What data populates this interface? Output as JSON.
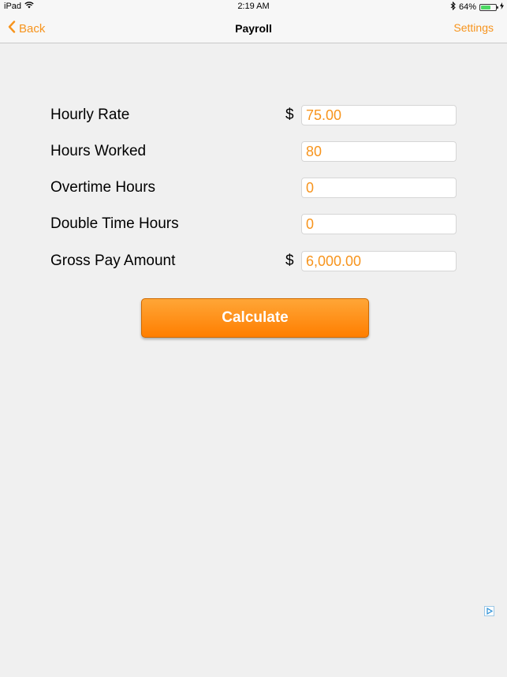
{
  "statusbar": {
    "device": "iPad",
    "time": "2:19 AM",
    "battery_text": "64%",
    "battery_level": 0.64
  },
  "navbar": {
    "back_label": "Back",
    "title": "Payroll",
    "settings_label": "Settings"
  },
  "form": {
    "hourly_rate": {
      "label": "Hourly Rate",
      "currency": "$",
      "value": "75.00"
    },
    "hours_worked": {
      "label": "Hours Worked",
      "value": "80"
    },
    "overtime_hours": {
      "label": "Overtime Hours",
      "value": "0"
    },
    "double_time_hours": {
      "label": "Double Time Hours",
      "value": "0"
    },
    "gross_pay": {
      "label": "Gross Pay Amount",
      "currency": "$",
      "value": "6,000.00"
    }
  },
  "calculate_label": "Calculate",
  "colors": {
    "accent": "#f7941d",
    "button_top": "#ffa637",
    "button_bottom": "#ff7e00",
    "background": "#f0f0f0"
  },
  "icons": [
    "wifi-icon",
    "bluetooth-icon",
    "battery-icon",
    "charging-icon",
    "chevron-left-icon",
    "ad-choices-icon"
  ]
}
